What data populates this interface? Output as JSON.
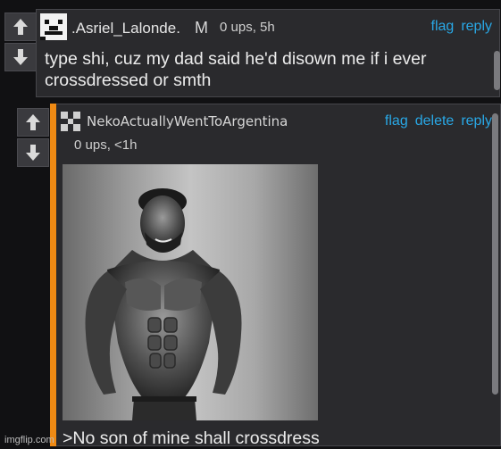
{
  "comments": [
    {
      "username": ".Asriel_Lalonde.",
      "badge": "M",
      "meta": "0 ups, 5h",
      "actions": [
        "flag",
        "reply"
      ],
      "text": "type shi, cuz my dad said he'd disown me if i ever crossdressed or smth"
    },
    {
      "username": "NekoActuallyWentToArgentina",
      "meta": "0 ups, <1h",
      "actions": [
        "flag",
        "delete",
        "reply"
      ],
      "text": ">No son of mine shall crossdress"
    }
  ],
  "vote_icons": [
    "arrow-up-icon",
    "arrow-down-icon"
  ],
  "colors": {
    "link": "#29a8e6",
    "reply_bar": "#ef8a14",
    "panel": "#2a2a2d",
    "page_bg": "#111113"
  },
  "watermark": "imgflip.com"
}
